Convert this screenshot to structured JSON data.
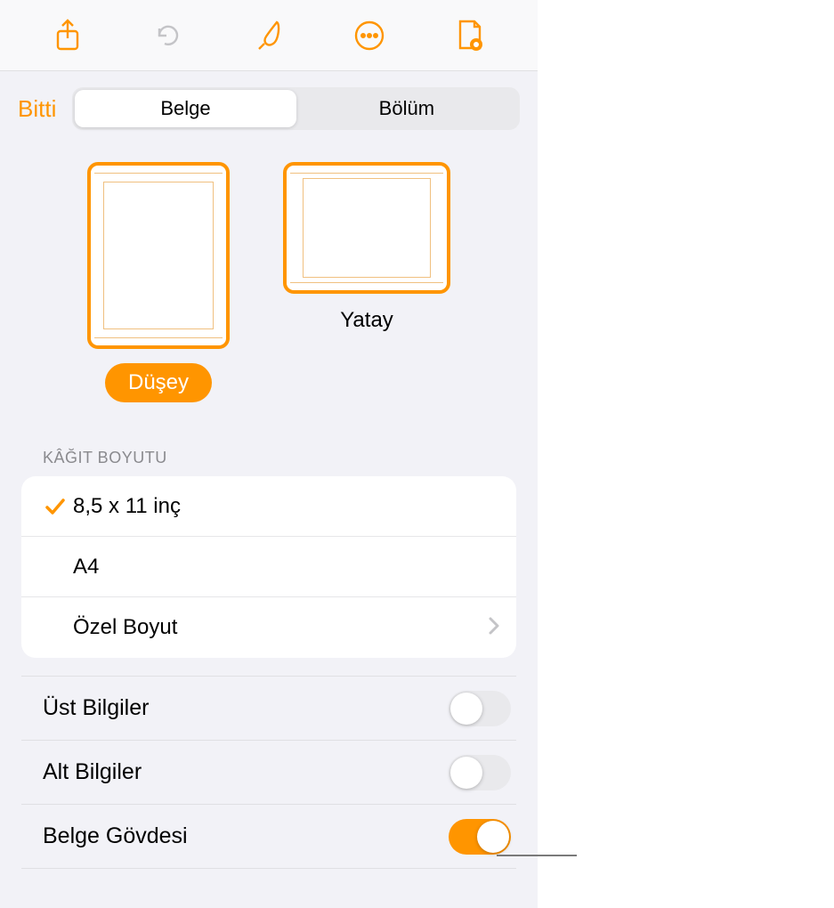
{
  "colors": {
    "accent": "#ff9500"
  },
  "toolbar": {
    "share_icon": "share",
    "undo_icon": "undo",
    "brush_icon": "brush",
    "more_icon": "more",
    "doc_icon": "document"
  },
  "header": {
    "done_label": "Bitti",
    "segments": {
      "document": "Belge",
      "section": "Bölüm",
      "active": "document"
    }
  },
  "orientation": {
    "portrait_label": "Düşey",
    "landscape_label": "Yatay",
    "selected": "portrait"
  },
  "paper_size": {
    "header": "KÂĞIT BOYUTU",
    "options": [
      {
        "label": "8,5 x 11 inç",
        "selected": true,
        "disclosure": false
      },
      {
        "label": "A4",
        "selected": false,
        "disclosure": false
      },
      {
        "label": "Özel Boyut",
        "selected": false,
        "disclosure": true
      }
    ]
  },
  "toggles": {
    "headers": {
      "label": "Üst Bilgiler",
      "on": false
    },
    "footers": {
      "label": "Alt Bilgiler",
      "on": false
    },
    "body": {
      "label": "Belge Gövdesi",
      "on": true
    }
  }
}
